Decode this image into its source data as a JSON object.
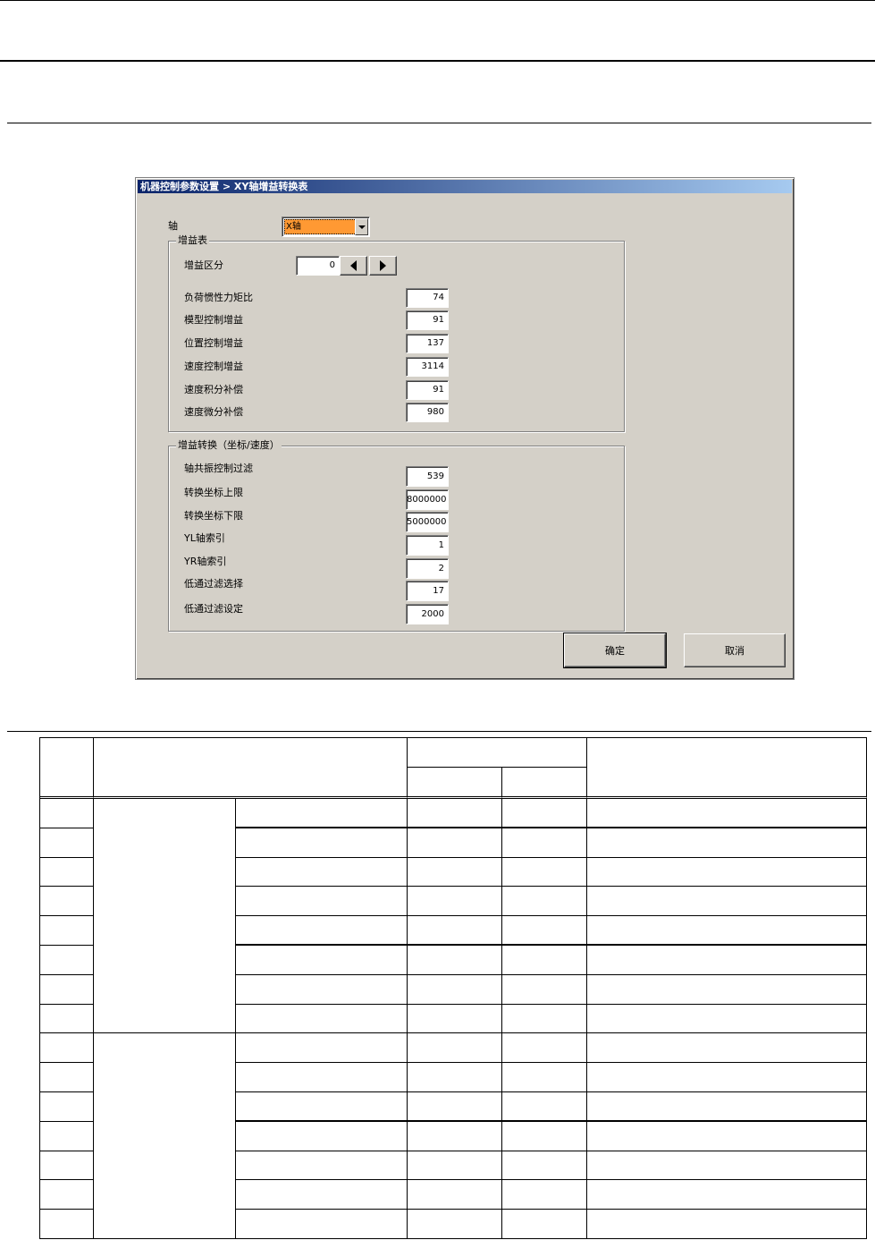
{
  "dialog": {
    "title": "机器控制参数设置 > XY轴增益转换表",
    "axis": {
      "label": "轴",
      "value": "X轴"
    },
    "gain_table": {
      "label": "增益表",
      "division": {
        "label": "增益区分",
        "value": "0"
      },
      "rows": [
        {
          "label": "负荷惯性力矩比",
          "value": "74"
        },
        {
          "label": "模型控制增益",
          "value": "91"
        },
        {
          "label": "位置控制增益",
          "value": "137"
        },
        {
          "label": "速度控制增益",
          "value": "3114"
        },
        {
          "label": "速度积分补偿",
          "value": "91"
        },
        {
          "label": "速度微分补偿",
          "value": "980"
        }
      ]
    },
    "gain_conversion": {
      "label": "增益转换（坐标/速度）",
      "rows": [
        {
          "label": "轴共振控制过滤",
          "value": "539"
        },
        {
          "label": "转换坐标上限",
          "value": "8000000"
        },
        {
          "label": "转换坐标下限",
          "value": "5000000"
        },
        {
          "label": "YL轴索引",
          "value": "1"
        },
        {
          "label": "YR轴索引",
          "value": "2"
        },
        {
          "label": "低通过滤选择",
          "value": "17"
        },
        {
          "label": "低通过滤设定",
          "value": "2000"
        }
      ]
    },
    "buttons": {
      "ok": "确定",
      "cancel": "取消"
    }
  },
  "icons": {
    "select_arrow": "chevron-down-icon",
    "decrement": "left-arrow-icon",
    "increment": "right-arrow-icon"
  },
  "colors": {
    "title_bar_start": "#0a246a",
    "title_bar_end": "#a6caf0",
    "dialog_background": "#d4d0c8",
    "select_highlight": "#ff9933"
  }
}
